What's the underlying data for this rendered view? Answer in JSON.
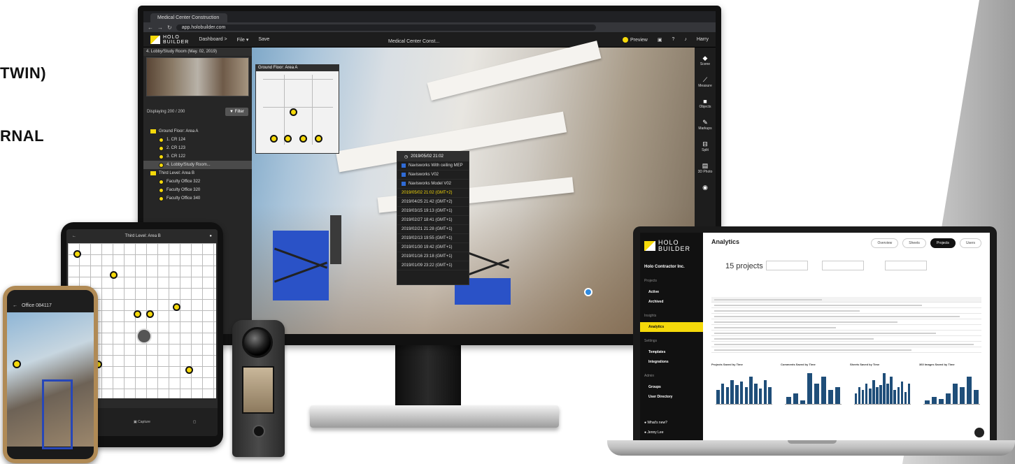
{
  "side_text": {
    "line1": "TWIN)",
    "line2": "RNAL"
  },
  "monitor": {
    "browser": {
      "tab_title": "Medical Center Construction",
      "url": "app.holobuilder.com"
    },
    "header": {
      "logo_line1": "HOLO",
      "logo_line2": "BUILDER",
      "menu": [
        "Dashboard >",
        "File ▾",
        "Save"
      ],
      "center_title": "Medical Center Const...",
      "preview_label": "Preview",
      "user": "Harry"
    },
    "left_panel": {
      "title": "4. Lobby/Study Room (May. 02, 2019)",
      "displaying": "Displaying 200 / 200",
      "filter_label": "Filter",
      "tree": [
        {
          "label": "Ground Floor: Area A",
          "type": "folder",
          "child": false
        },
        {
          "label": "1. CR 124",
          "type": "dot",
          "child": true
        },
        {
          "label": "2. CR 123",
          "type": "dot",
          "child": true
        },
        {
          "label": "3. CR 122",
          "type": "dot",
          "child": true
        },
        {
          "label": "4. Lobby/Study Room...",
          "type": "dot",
          "child": true,
          "selected": true
        },
        {
          "label": "Third Level: Area B",
          "type": "folder",
          "child": false
        },
        {
          "label": "Faculty Office 322",
          "type": "dot",
          "child": true
        },
        {
          "label": "Faculty Office 320",
          "type": "dot",
          "child": true
        },
        {
          "label": "Faculty Office 340",
          "type": "dot",
          "child": true
        }
      ]
    },
    "floorplan_title": "Ground Floor: Area A",
    "timeline": {
      "head": "2019/05/02 21:02",
      "navisworks": [
        "Navisworks With ceiling MEP",
        "Navisworks V02",
        "Navisworks Model V02"
      ],
      "dates": [
        "2019/05/02 21:02 (GMT+2)",
        "2019/04/25 21:42 (GMT+2)",
        "2019/03/15 19:13 (GMT+1)",
        "2019/02/27 18:41 (GMT+1)",
        "2019/02/21 21:28 (GMT+1)",
        "2019/02/13 19:55 (GMT+1)",
        "2019/01/30 19:42 (GMT+1)",
        "2019/01/16 23:18 (GMT+1)",
        "2019/01/09 23:22 (GMT+1)"
      ]
    },
    "toolbar": [
      {
        "icon": "scene-icon",
        "label": "Scene"
      },
      {
        "icon": "measure-icon",
        "label": "Measure"
      },
      {
        "icon": "objects-icon",
        "label": "Objects"
      },
      {
        "icon": "markups-icon",
        "label": "Markups"
      },
      {
        "icon": "split-icon",
        "label": "Split"
      },
      {
        "icon": "bim-icon",
        "label": "3D Photo"
      },
      {
        "icon": "more-icon",
        "label": ""
      }
    ]
  },
  "tablet": {
    "title": "Third Level: Area B",
    "footer": [
      "",
      "Capture",
      ""
    ]
  },
  "phone": {
    "title": "Office 084117"
  },
  "laptop": {
    "logo_line1": "HOLO",
    "logo_line2": "BUILDER",
    "org": "Holo Contractor Inc.",
    "sections": [
      {
        "title": "Projects",
        "items": [
          "Active",
          "Archived"
        ]
      },
      {
        "title": "Insights",
        "items": [
          "Analytics"
        ]
      },
      {
        "title": "Settings",
        "items": [
          "Templates",
          "Integrations"
        ]
      },
      {
        "title": "Admin",
        "items": [
          "Groups",
          "User Directory"
        ]
      }
    ],
    "active_item": "Analytics",
    "bottom": [
      "What's new?",
      "Jenny Lee"
    ],
    "title": "Analytics",
    "tabs": [
      "Overview",
      "Sheets",
      "Projects",
      "Users"
    ],
    "active_tab": "Projects",
    "project_count": "15 projects",
    "chart_titles": [
      "Projects Saved by Time",
      "Comments Saved by Time",
      "Sheets Saved by Time",
      "360 Images Saved by Time"
    ]
  },
  "colors": {
    "accent": "#f5d90a",
    "bar": "#1f4e79",
    "nav_blue": "#2f6bd6"
  }
}
